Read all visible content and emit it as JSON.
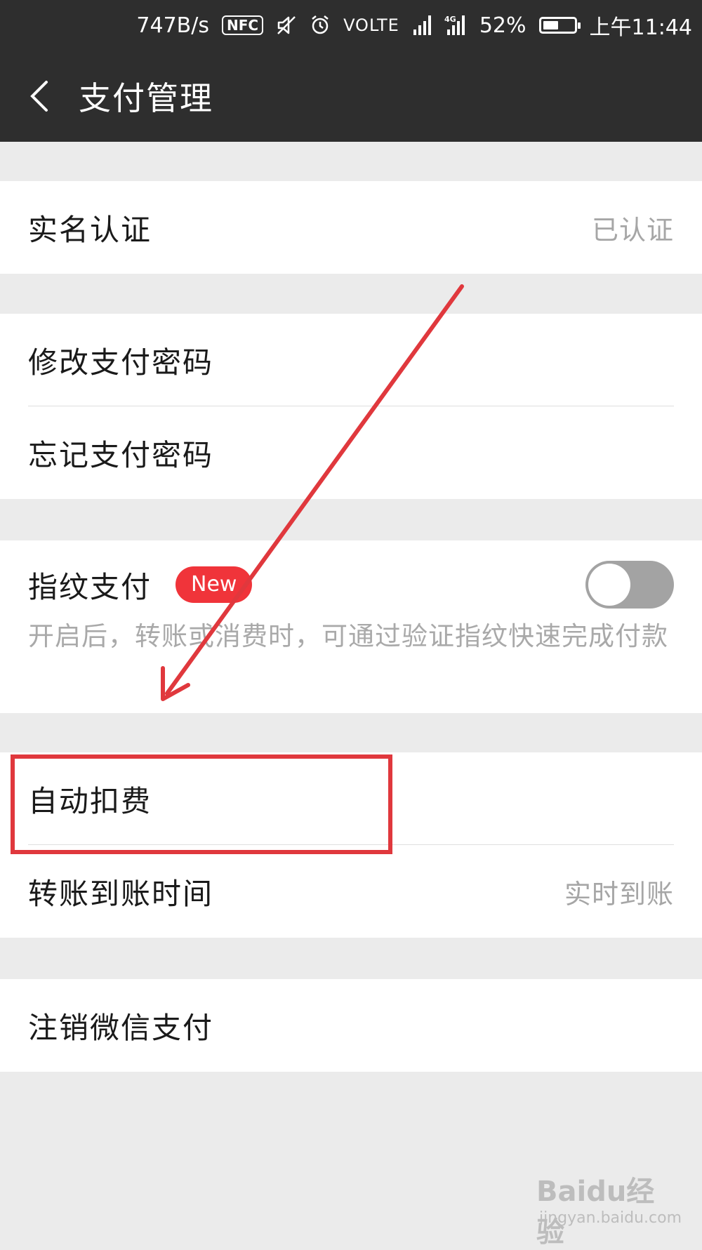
{
  "status_bar": {
    "net_speed": "747B/s",
    "nfc": "NFC",
    "volte": "VOLTE",
    "battery_percent": "52%",
    "battery_level": 0.52,
    "time": "上午11:44"
  },
  "nav": {
    "title": "支付管理"
  },
  "groups": {
    "identity": {
      "label": "实名认证",
      "value": "已认证"
    },
    "password": {
      "change_label": "修改支付密码",
      "forgot_label": "忘记支付密码"
    },
    "fingerprint": {
      "label": "指纹支付",
      "badge": "New",
      "toggle_on": false,
      "description": "开启后，转账或消费时，可通过验证指纹快速完成付款"
    },
    "payment": {
      "auto_deduct_label": "自动扣费",
      "transfer_time_label": "转账到账时间",
      "transfer_time_value": "实时到账"
    },
    "cancel": {
      "label": "注销微信支付"
    }
  },
  "annotation": {
    "color": "#e0383d"
  },
  "watermark": {
    "main": "Baidu经验",
    "sub": "jingyan.baidu.com"
  }
}
